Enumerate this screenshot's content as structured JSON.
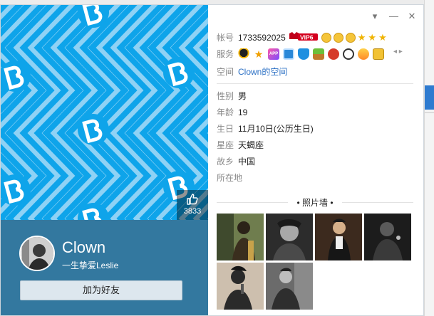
{
  "profile": {
    "nickname": "Clown",
    "signature": "一生挚爱Leslie",
    "add_friend_label": "加为好友",
    "like_count": "3833"
  },
  "window": {
    "controls": [
      "dropdown-icon",
      "minimize-icon",
      "close-icon"
    ]
  },
  "info": {
    "account_label": "帐号",
    "account_value": "1733592025",
    "vip_badge": "VIP6",
    "services_label": "服务",
    "space_label": "空间",
    "space_value": "Clown的空间",
    "gender_label": "性别",
    "gender_value": "男",
    "age_label": "年龄",
    "age_value": "19",
    "birthday_label": "生日",
    "birthday_value": "11月10日(公历生日)",
    "zodiac_label": "星座",
    "zodiac_value": "天蝎座",
    "hometown_label": "故乡",
    "hometown_value": "中国",
    "location_label": "所在地",
    "location_value": ""
  },
  "photos": {
    "title": "• 照片墙 •",
    "count": 6
  },
  "colors": {
    "cover_blue": "#0ea4ea",
    "cover_light": "#8fd2f5",
    "profile_bg": "#33789f",
    "link": "#2a6fc4"
  },
  "icons": {
    "services": [
      "penguin-icon",
      "star-icon",
      "app-icon",
      "photo-icon",
      "shield-icon",
      "gift-icon",
      "video-icon",
      "cow-icon",
      "pet-icon",
      "phone-icon"
    ]
  }
}
